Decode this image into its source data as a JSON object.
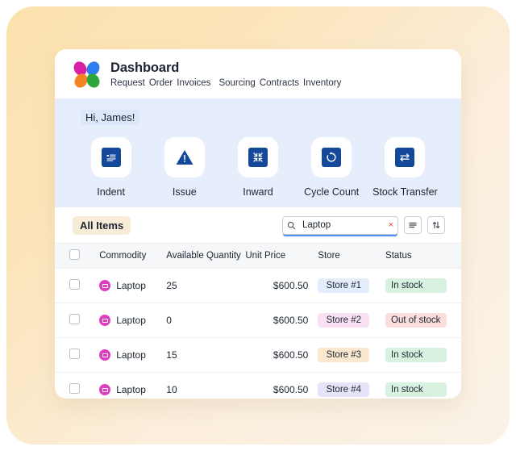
{
  "header": {
    "logo_name": "butterfly-logo",
    "title": "Dashboard",
    "nav": [
      {
        "label": "Request"
      },
      {
        "label": "Order"
      },
      {
        "label": "Invoices"
      },
      {
        "label": "Sourcing"
      },
      {
        "label": "Contracts"
      },
      {
        "label": "Inventory"
      }
    ]
  },
  "quick_panel": {
    "greeting": "Hi, James!",
    "actions": [
      {
        "label": "Indent",
        "icon": "document-list-icon"
      },
      {
        "label": "Issue",
        "icon": "triangle-alert-icon"
      },
      {
        "label": "Inward",
        "icon": "collapse-arrows-icon"
      },
      {
        "label": "Cycle Count",
        "icon": "refresh-circle-icon"
      },
      {
        "label": "Stock Transfer",
        "icon": "transfer-arrows-icon"
      }
    ]
  },
  "toolbar": {
    "tab_label": "All Items",
    "search": {
      "value": "Laptop",
      "placeholder": "Search",
      "clear_label": "×"
    },
    "filter_label": "filter-icon",
    "sort_label": "sort-icon"
  },
  "table": {
    "columns": [
      "Commodity",
      "Available Quantity",
      "Unit Price",
      "Store",
      "Status"
    ],
    "rows": [
      {
        "commodity": "Laptop",
        "quantity": "25",
        "price": "$600.50",
        "store": "Store #1",
        "store_bg": "#e3edfb",
        "store_fg": "#1b2430",
        "status": "In stock",
        "status_bg": "#d9f2e0",
        "status_fg": "#1b2430"
      },
      {
        "commodity": "Laptop",
        "quantity": "0",
        "price": "$600.50",
        "store": "Store #2",
        "store_bg": "#f9e1f3",
        "store_fg": "#1b2430",
        "status": "Out of stock",
        "status_bg": "#fbdedc",
        "status_fg": "#1b2430"
      },
      {
        "commodity": "Laptop",
        "quantity": "15",
        "price": "$600.50",
        "store": "Store #3",
        "store_bg": "#fbe8cf",
        "store_fg": "#1b2430",
        "status": "In stock",
        "status_bg": "#d9f2e0",
        "status_fg": "#1b2430"
      },
      {
        "commodity": "Laptop",
        "quantity": "10",
        "price": "$600.50",
        "store": "Store #4",
        "store_bg": "#e6e4f8",
        "store_fg": "#1b2430",
        "status": "In stock",
        "status_bg": "#d9f2e0",
        "status_fg": "#1b2430"
      }
    ]
  },
  "colors": {
    "accent_blue": "#14489b",
    "panel_blue": "#e7eefb",
    "tab_cream": "#f8ecd9",
    "clear_red": "#e8453c",
    "commodity_pink": "#e03ec0"
  }
}
